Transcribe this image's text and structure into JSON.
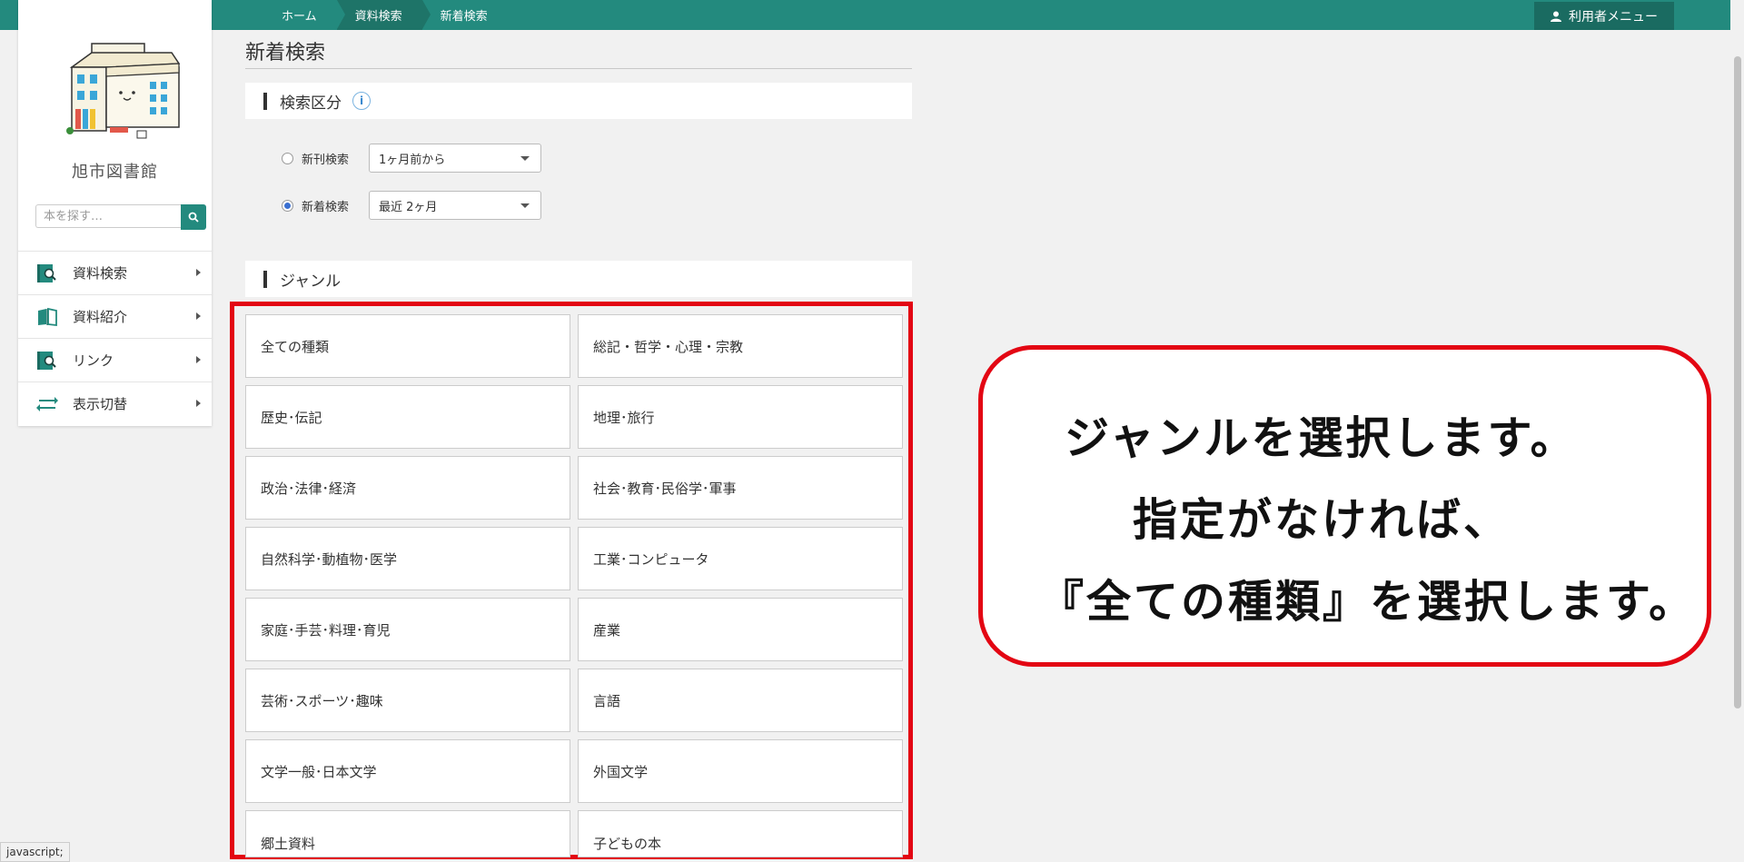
{
  "breadcrumbs": [
    "ホーム",
    "資料検索",
    "新着検索"
  ],
  "user_menu": {
    "label": "利用者メニュー"
  },
  "sidebar": {
    "library_name": "旭市図書館",
    "search_placeholder": "本を探す…",
    "menu": [
      {
        "label": "資料検索",
        "icon": "search-book-icon"
      },
      {
        "label": "資料紹介",
        "icon": "open-book-icon"
      },
      {
        "label": "リンク",
        "icon": "link-book-icon"
      },
      {
        "label": "表示切替",
        "icon": "swap-arrows-icon"
      }
    ]
  },
  "main": {
    "page_title": "新着検索",
    "search_type": {
      "heading": "検索区分",
      "options": [
        {
          "label": "新刊検索",
          "checked": false,
          "selected": "1ヶ月前から"
        },
        {
          "label": "新着検索",
          "checked": true,
          "selected": "最近 2ヶ月"
        }
      ]
    },
    "genre": {
      "heading": "ジャンル",
      "items": [
        "全ての種類",
        "総記・哲学・心理・宗教",
        "歴史･伝記",
        "地理･旅行",
        "政治･法律･経済",
        "社会･教育･民俗学･軍事",
        "自然科学･動植物･医学",
        "工業･コンピュータ",
        "家庭･手芸･料理･育児",
        "産業",
        "芸術･スポーツ･趣味",
        "言語",
        "文学一般･日本文学",
        "外国文学",
        "郷土資料",
        "子どもの本"
      ]
    }
  },
  "callout": {
    "lines": [
      "ジャンルを選択します。",
      "指定がなければ、",
      "『全ての種類』を選択します。"
    ]
  },
  "status_bar": {
    "text": "javascript;"
  },
  "colors": {
    "brand": "#238a7e",
    "highlight": "#e30613",
    "radio": "#3a6fd1"
  }
}
